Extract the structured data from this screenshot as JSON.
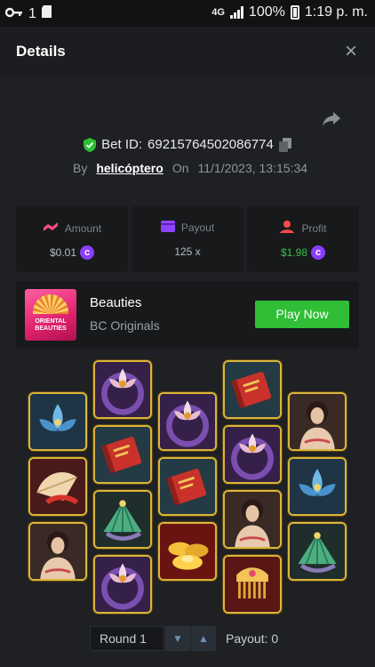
{
  "status_bar": {
    "left_indicator": "1",
    "network": "4G",
    "battery": "100%",
    "time": "1:19 p. m."
  },
  "header": {
    "title": "Details",
    "close_label": "×"
  },
  "bet": {
    "id_label": "Bet ID:",
    "id": "69215764502086774",
    "by_label": "By",
    "user": "helicóptero",
    "on_label": "On",
    "date": "11/1/2023, 13:15:34"
  },
  "stats": {
    "amount": {
      "label": "Amount",
      "value": "$0.01",
      "icon_color": "#ff4b7d"
    },
    "payout": {
      "label": "Payout",
      "value": "125 x",
      "icon_color": "#8e44ff"
    },
    "profit": {
      "label": "Profit",
      "value": "$1.98",
      "icon_color": "#ff4b4b",
      "value_color": "#3bc14a"
    },
    "coin_symbol": "c"
  },
  "game": {
    "thumbnail_text": "ORIENTAL BEAUTIES",
    "name": "Beauties",
    "provider": "BC Originals",
    "play_label": "Play Now"
  },
  "reels": [
    [
      "blue-lotus",
      "fan",
      "woman-portrait"
    ],
    [
      "purple-lotus",
      "red-book",
      "jade-fan",
      "purple-lotus"
    ],
    [
      "purple-lotus",
      "red-book",
      "gold-ingots"
    ],
    [
      "red-book",
      "purple-lotus",
      "woman-portrait",
      "comb"
    ],
    [
      "woman-portrait",
      "blue-lotus",
      "jade-fan"
    ]
  ],
  "footer": {
    "round_label": "Round 1",
    "payout_label": "Payout: 0"
  },
  "colors": {
    "accent_green": "#2fbe36",
    "tile_border": "#d9b53a",
    "background": "#1e2023"
  }
}
